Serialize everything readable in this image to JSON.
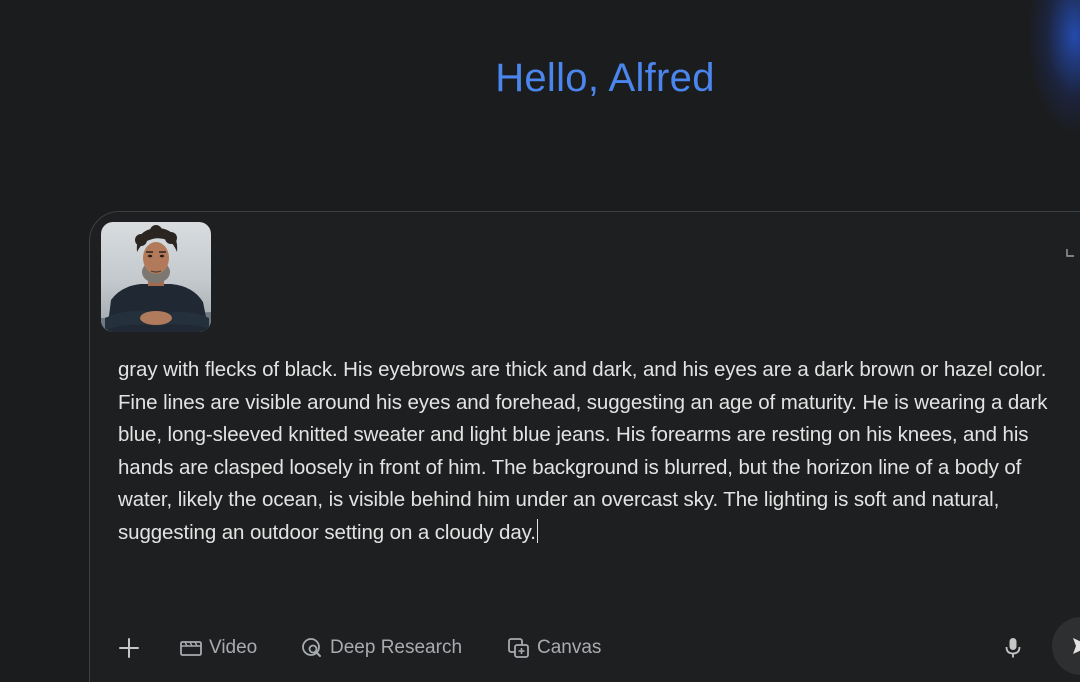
{
  "header": {
    "greeting": "Hello, Alfred"
  },
  "composer": {
    "attachment": {
      "kind": "image"
    },
    "prompt_text": "gray with flecks of black. His eyebrows are thick and dark, and his eyes are a dark brown or hazel color. Fine lines are visible around his eyes and forehead, suggesting an age of maturity. He is wearing a dark blue, long-sleeved knitted sweater and light blue jeans. His forearms are resting on his knees, and his hands are clasped loosely in front of him. The background is blurred, but the horizon line of a body of water, likely the ocean, is visible behind him under an overcast sky. The lighting is soft and natural, suggesting an outdoor setting on a cloudy day.",
    "toolbar": {
      "add_icon": "plus-icon",
      "video_label": "Video",
      "video_icon": "film-icon",
      "deep_research_label": "Deep Research",
      "deep_research_icon": "deep-research-icon",
      "canvas_label": "Canvas",
      "canvas_icon": "canvas-icon",
      "mic_icon": "microphone-icon",
      "send_icon": "send-icon"
    }
  },
  "colors": {
    "background": "#1b1c1d",
    "greeting": "#4b86ee",
    "text": "#e3e3e3",
    "tool_text": "#a8abaf",
    "border": "#3c4043"
  }
}
